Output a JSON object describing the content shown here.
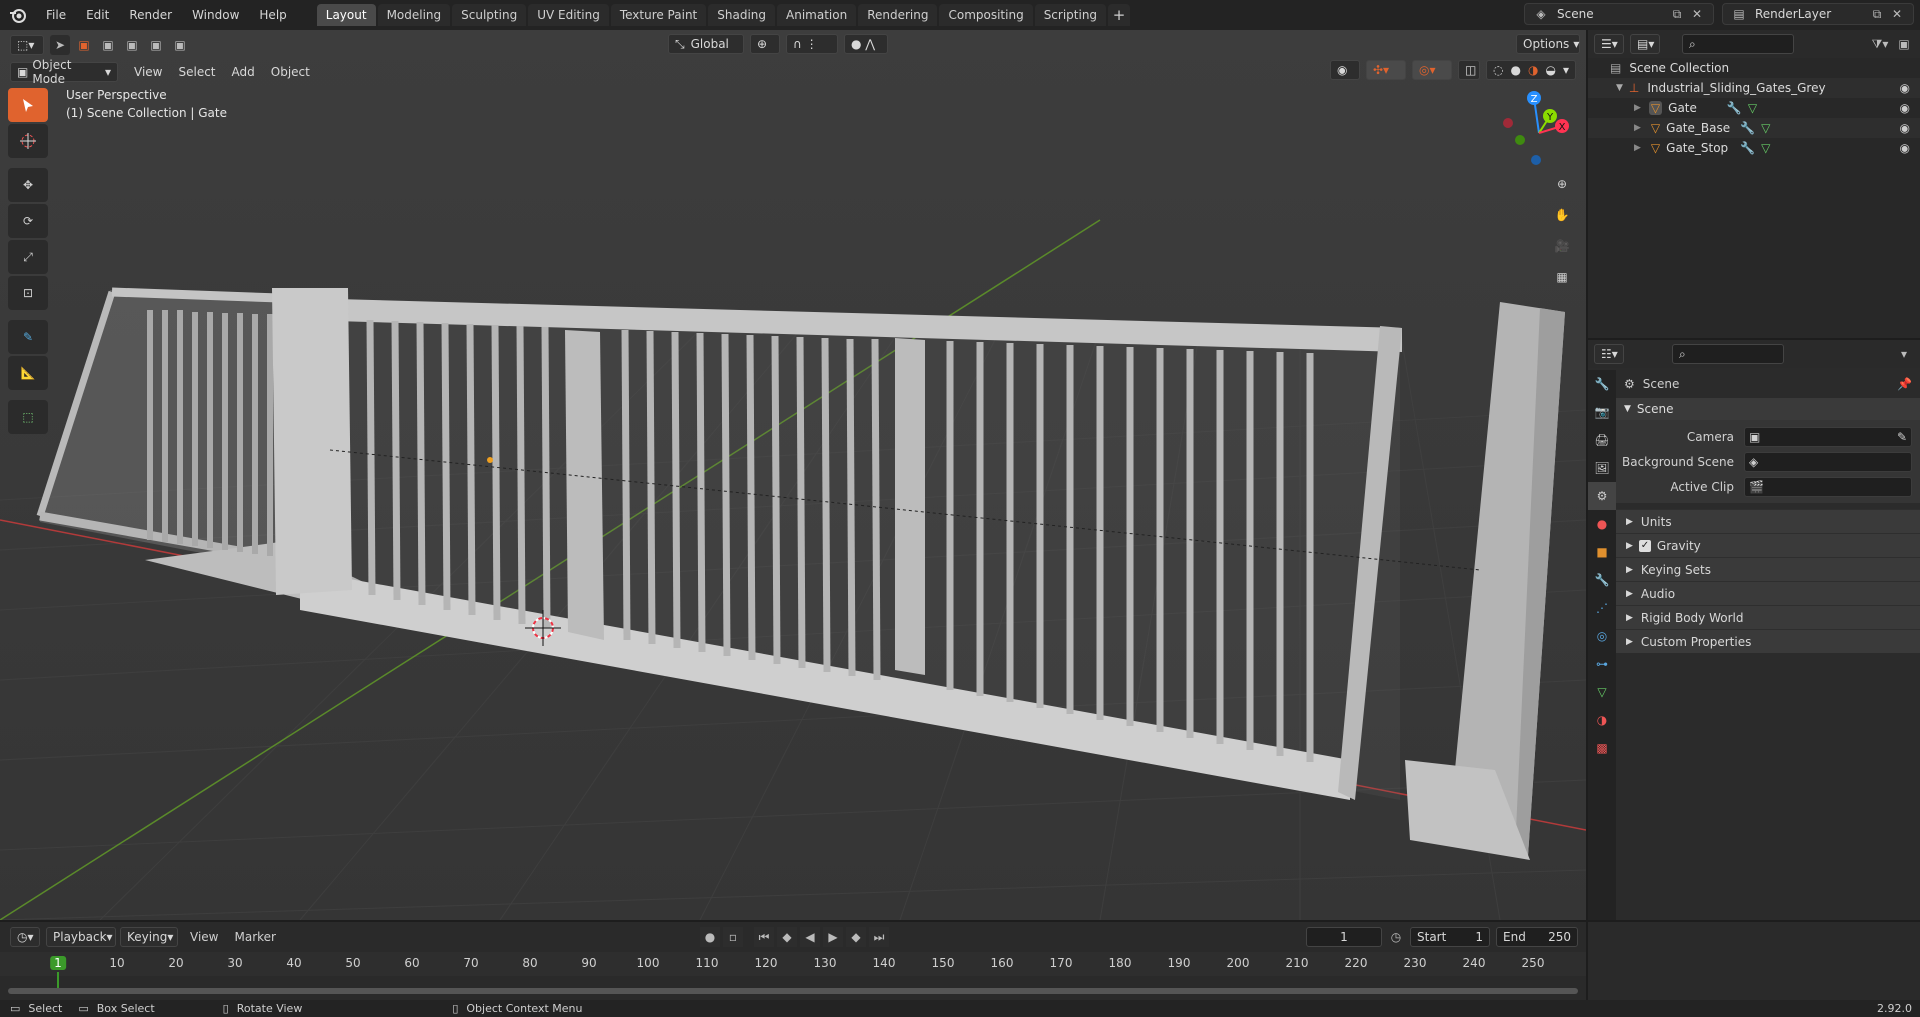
{
  "menu": [
    "File",
    "Edit",
    "Render",
    "Window",
    "Help"
  ],
  "workspaces": [
    "Layout",
    "Modeling",
    "Sculpting",
    "UV Editing",
    "Texture Paint",
    "Shading",
    "Animation",
    "Rendering",
    "Compositing",
    "Scripting"
  ],
  "active_workspace": "Layout",
  "scene_name": "Scene",
  "view_layer": "RenderLayer",
  "viewport": {
    "mode": "Object Mode",
    "menus": [
      "View",
      "Select",
      "Add",
      "Object"
    ],
    "transform_orientation": "Global",
    "options_label": "Options",
    "perspective_label": "User Perspective",
    "context_label": "(1) Scene Collection | Gate"
  },
  "gizmo": {
    "x": "X",
    "y": "Y",
    "z": "Z"
  },
  "outliner": {
    "root": "Scene Collection",
    "collection": "Industrial_Sliding_Gates_Grey",
    "objects": [
      "Gate",
      "Gate_Base",
      "Gate_Stop"
    ]
  },
  "properties": {
    "context": "Scene",
    "panel": "Scene",
    "fields": [
      {
        "label": "Camera",
        "value": ""
      },
      {
        "label": "Background Scene",
        "value": ""
      },
      {
        "label": "Active Clip",
        "value": ""
      }
    ],
    "subpanels": [
      "Units",
      "Gravity",
      "Keying Sets",
      "Audio",
      "Rigid Body World",
      "Custom Properties"
    ],
    "gravity_enabled": true
  },
  "timeline": {
    "menus": [
      "Playback",
      "Keying",
      "View",
      "Marker"
    ],
    "current_frame": "1",
    "start_label": "Start",
    "start": "1",
    "end_label": "End",
    "end": "250",
    "ticks": [
      "1",
      "10",
      "20",
      "30",
      "40",
      "50",
      "60",
      "70",
      "80",
      "90",
      "100",
      "110",
      "120",
      "130",
      "140",
      "150",
      "160",
      "170",
      "180",
      "190",
      "200",
      "210",
      "220",
      "230",
      "240",
      "250"
    ]
  },
  "status": {
    "select": "Select",
    "box_select": "Box Select",
    "rotate_view": "Rotate View",
    "context_menu": "Object Context Menu",
    "version": "2.92.0"
  },
  "colors": {
    "accent": "#e0632e",
    "x_axis": "#ff3352",
    "y_axis": "#8bdc00",
    "z_axis": "#2890ff",
    "frame": "#3b9a2a"
  }
}
